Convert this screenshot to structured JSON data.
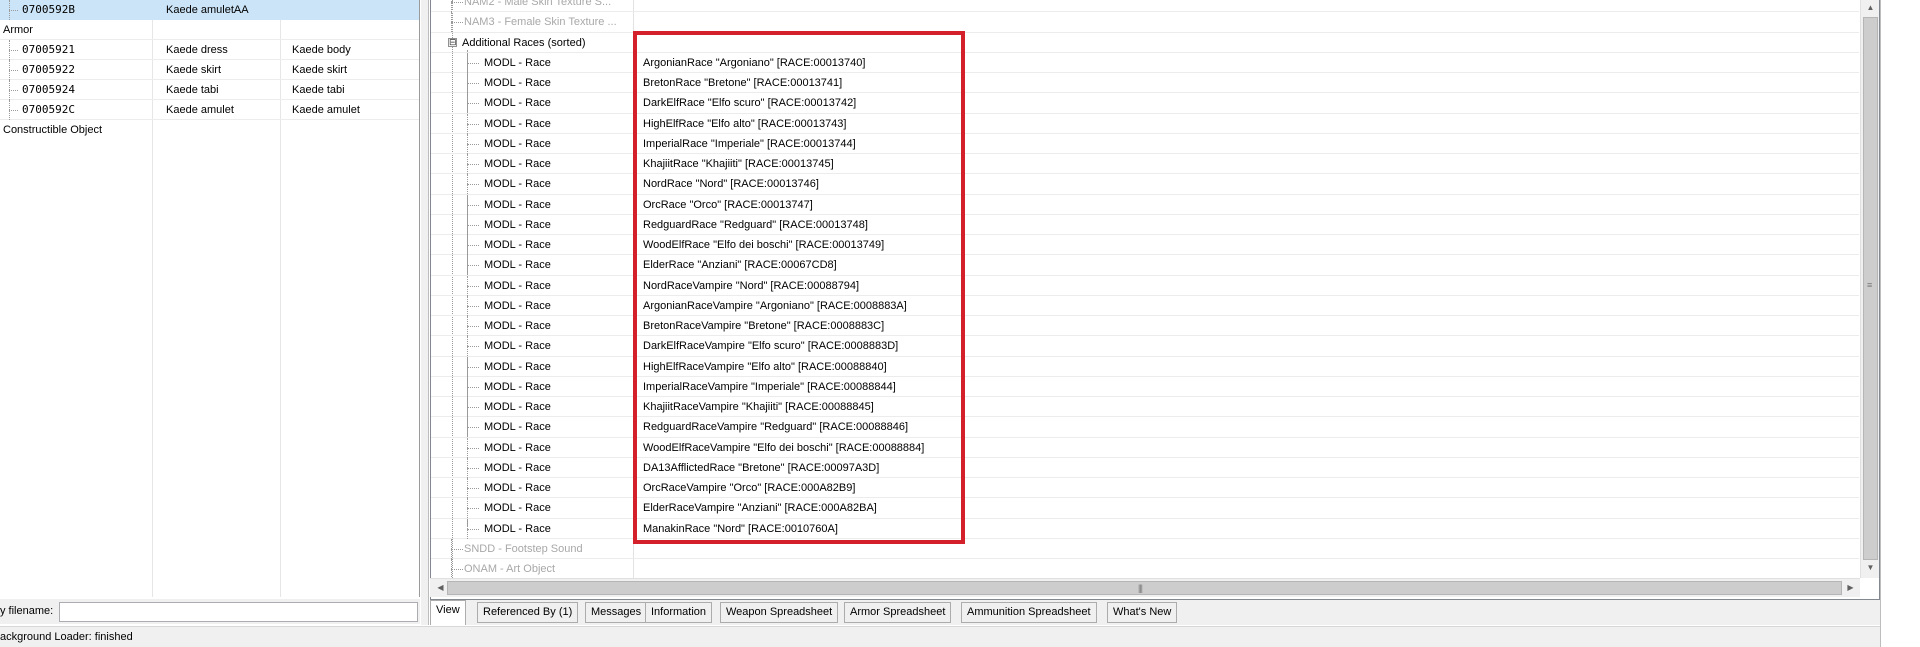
{
  "left_pane": {
    "top_row": {
      "form_id": "0700592B",
      "editor_id": "Kaede amuletAA"
    },
    "categories": [
      {
        "label": "Armor",
        "items": [
          {
            "form_id": "07005921",
            "editor_id": "Kaede dress",
            "name": "Kaede body"
          },
          {
            "form_id": "07005922",
            "editor_id": "Kaede skirt",
            "name": "Kaede skirt"
          },
          {
            "form_id": "07005924",
            "editor_id": "Kaede tabi",
            "name": "Kaede tabi"
          },
          {
            "form_id": "0700592C",
            "editor_id": "Kaede amulet",
            "name": "Kaede amulet"
          }
        ]
      },
      {
        "label": "Constructible Object",
        "items": []
      }
    ],
    "filename_label": "y filename:",
    "filename_value": ""
  },
  "record_view": {
    "top_rows": [
      {
        "field": "NAM2 - Male Skin Texture S..."
      },
      {
        "field": "NAM3 - Female Skin Texture ..."
      }
    ],
    "group": {
      "label": "Additional Races (sorted)",
      "expander": "⊟"
    },
    "race_rows": [
      {
        "field": "MODL - Race",
        "value": "ArgonianRace \"Argoniano\" [RACE:00013740]"
      },
      {
        "field": "MODL - Race",
        "value": "BretonRace \"Bretone\" [RACE:00013741]"
      },
      {
        "field": "MODL - Race",
        "value": "DarkElfRace \"Elfo scuro\" [RACE:00013742]"
      },
      {
        "field": "MODL - Race",
        "value": "HighElfRace \"Elfo alto\" [RACE:00013743]"
      },
      {
        "field": "MODL - Race",
        "value": "ImperialRace \"Imperiale\" [RACE:00013744]"
      },
      {
        "field": "MODL - Race",
        "value": "KhajiitRace \"Khajiiti\" [RACE:00013745]"
      },
      {
        "field": "MODL - Race",
        "value": "NordRace \"Nord\" [RACE:00013746]"
      },
      {
        "field": "MODL - Race",
        "value": "OrcRace \"Orco\" [RACE:00013747]"
      },
      {
        "field": "MODL - Race",
        "value": "RedguardRace \"Redguard\" [RACE:00013748]"
      },
      {
        "field": "MODL - Race",
        "value": "WoodElfRace \"Elfo dei boschi\" [RACE:00013749]"
      },
      {
        "field": "MODL - Race",
        "value": "ElderRace \"Anziani\" [RACE:00067CD8]"
      },
      {
        "field": "MODL - Race",
        "value": "NordRaceVampire \"Nord\" [RACE:00088794]"
      },
      {
        "field": "MODL - Race",
        "value": "ArgonianRaceVampire \"Argoniano\" [RACE:0008883A]"
      },
      {
        "field": "MODL - Race",
        "value": "BretonRaceVampire \"Bretone\" [RACE:0008883C]"
      },
      {
        "field": "MODL - Race",
        "value": "DarkElfRaceVampire \"Elfo scuro\" [RACE:0008883D]"
      },
      {
        "field": "MODL - Race",
        "value": "HighElfRaceVampire \"Elfo alto\" [RACE:00088840]"
      },
      {
        "field": "MODL - Race",
        "value": "ImperialRaceVampire \"Imperiale\" [RACE:00088844]"
      },
      {
        "field": "MODL - Race",
        "value": "KhajiitRaceVampire \"Khajiiti\" [RACE:00088845]"
      },
      {
        "field": "MODL - Race",
        "value": "RedguardRaceVampire \"Redguard\" [RACE:00088846]"
      },
      {
        "field": "MODL - Race",
        "value": "WoodElfRaceVampire \"Elfo dei boschi\" [RACE:00088884]"
      },
      {
        "field": "MODL - Race",
        "value": "DA13AfflictedRace \"Bretone\" [RACE:00097A3D]"
      },
      {
        "field": "MODL - Race",
        "value": "OrcRaceVampire \"Orco\" [RACE:000A82B9]"
      },
      {
        "field": "MODL - Race",
        "value": "ElderRaceVampire \"Anziani\" [RACE:000A82BA]"
      },
      {
        "field": "MODL - Race",
        "value": "ManakinRace \"Nord\" [RACE:0010760A]"
      }
    ],
    "bottom_rows": [
      {
        "field": "SNDD - Footstep Sound"
      },
      {
        "field": "ONAM - Art Object"
      }
    ],
    "highlight_color": "#d4202a"
  },
  "tabs": [
    {
      "label": "View",
      "active": true
    },
    {
      "label": "Referenced By (1)",
      "active": false
    },
    {
      "label": "Messages",
      "active": false
    },
    {
      "label": "Information",
      "active": false
    },
    {
      "label": "Weapon Spreadsheet",
      "active": false
    },
    {
      "label": "Armor Spreadsheet",
      "active": false
    },
    {
      "label": "Ammunition Spreadsheet",
      "active": false
    },
    {
      "label": "What's New",
      "active": false
    }
  ],
  "status": {
    "text": "ackground Loader: finished"
  },
  "scrollbars": {
    "up_arrow": "▲",
    "down_arrow": "▼",
    "left_arrow": "◀",
    "right_arrow": "▶",
    "grip": "≡",
    "hgrip": "|||"
  }
}
